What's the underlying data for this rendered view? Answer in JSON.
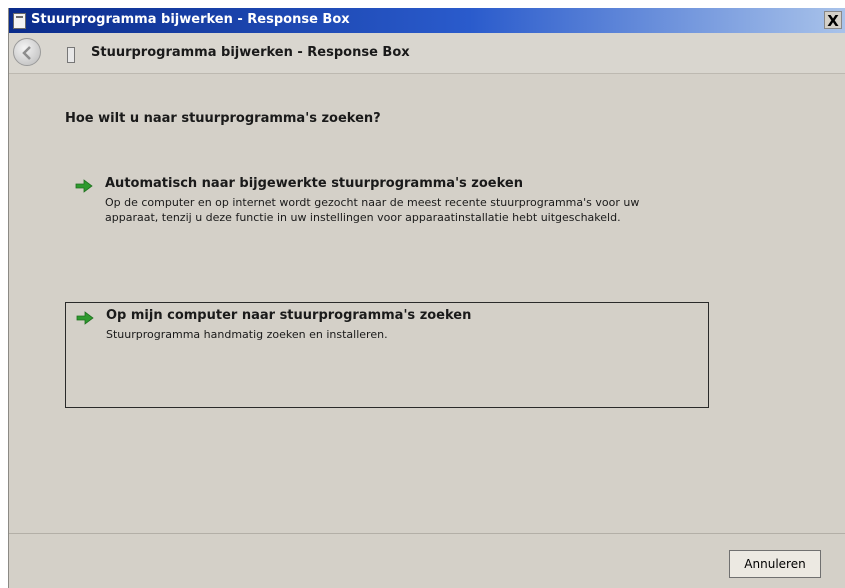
{
  "window": {
    "title": "Stuurprogramma bijwerken - Response Box",
    "close_glyph": "X"
  },
  "nav": {
    "title": "Stuurprogramma bijwerken - Response Box"
  },
  "question": "Hoe wilt u naar stuurprogramma's zoeken?",
  "options": [
    {
      "title": "Automatisch naar bijgewerkte stuurprogramma's zoeken",
      "description": "Op de computer en op internet wordt gezocht naar de meest recente stuurprogramma's voor uw apparaat, tenzij u deze functie in uw instellingen voor apparaatinstallatie hebt uitgeschakeld.",
      "icon": "green-arrow-icon"
    },
    {
      "title": "Op mijn computer naar stuurprogramma's zoeken",
      "description": "Stuurprogramma handmatig zoeken en installeren.",
      "icon": "green-arrow-icon"
    }
  ],
  "footer": {
    "cancel_label": "Annuleren"
  },
  "colors": {
    "titlebar_start": "#0a2b8a",
    "titlebar_end": "#a9c3ea",
    "dialog_bg": "#d4d0c8",
    "arrow_green": "#2e9a2e"
  }
}
